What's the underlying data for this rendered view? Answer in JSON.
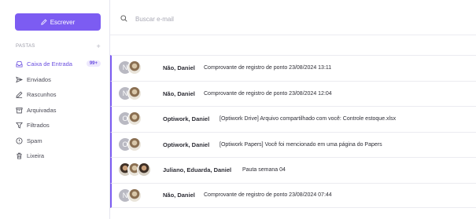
{
  "sidebar": {
    "compose_label": "Escrever",
    "folders_title": "PASTAS",
    "add_label": "+",
    "items": [
      {
        "label": "Caixa de Entrada",
        "badge": "99+",
        "icon": "inbox-icon",
        "active": true
      },
      {
        "label": "Enviados",
        "icon": "send-icon"
      },
      {
        "label": "Rascunhos",
        "icon": "pencil-icon"
      },
      {
        "label": "Arquivadas",
        "icon": "archive-icon"
      },
      {
        "label": "Filtrados",
        "icon": "filter-icon"
      },
      {
        "label": "Spam",
        "icon": "alert-icon"
      },
      {
        "label": "Lixeira",
        "icon": "trash-icon"
      }
    ]
  },
  "search": {
    "placeholder": "Buscar e-mail"
  },
  "emails": [
    {
      "avatar": "N",
      "sender": "Não, Daniel",
      "subject": "Comprovante de registro de ponto 23/08/2024 13:11"
    },
    {
      "avatar": "N",
      "sender": "Não, Daniel",
      "subject": "Comprovante de registro de ponto 23/08/2024 12:04"
    },
    {
      "avatar": "O",
      "sender": "Optiwork, Daniel",
      "subject": "[Optiwork Drive] Arquivo compartilhado com você: Controle estoque.xlsx"
    },
    {
      "avatar": "O",
      "sender": "Optiwork, Daniel",
      "subject": "[Optiwork Papers] Você foi mencionado em uma página do Papers"
    },
    {
      "avatar": "",
      "sender": "Juliano, Eduarda, Daniel",
      "subject": "Pauta semana 04"
    },
    {
      "avatar": "N",
      "sender": "Não, Daniel",
      "subject": "Comprovante de registro de ponto 23/08/2024 07:44"
    }
  ],
  "colors": {
    "accent": "#7c5cf2",
    "badge_bg": "#ede8fd"
  }
}
